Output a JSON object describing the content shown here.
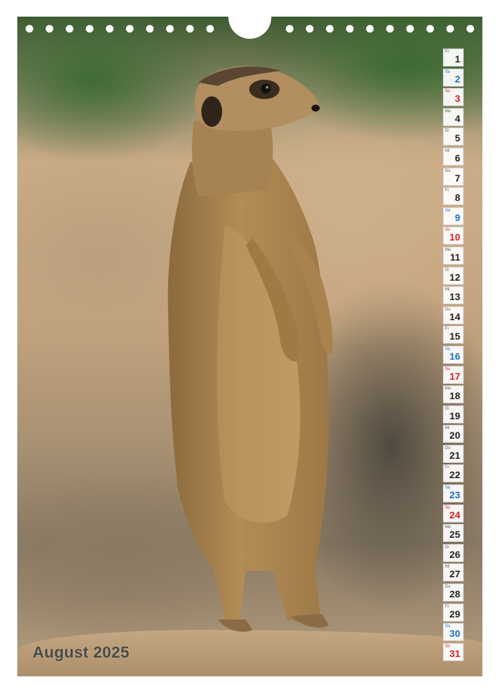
{
  "calendar": {
    "title": "August 2025",
    "days": [
      {
        "wd": "Fr",
        "num": "1",
        "type": "weekday"
      },
      {
        "wd": "Sa",
        "num": "2",
        "type": "sat"
      },
      {
        "wd": "So",
        "num": "3",
        "type": "sun"
      },
      {
        "wd": "Mo",
        "num": "4",
        "type": "weekday"
      },
      {
        "wd": "Di",
        "num": "5",
        "type": "weekday"
      },
      {
        "wd": "Mi",
        "num": "6",
        "type": "weekday"
      },
      {
        "wd": "Do",
        "num": "7",
        "type": "weekday"
      },
      {
        "wd": "Fr",
        "num": "8",
        "type": "weekday"
      },
      {
        "wd": "Sa",
        "num": "9",
        "type": "sat"
      },
      {
        "wd": "So",
        "num": "10",
        "type": "sun"
      },
      {
        "wd": "Mo",
        "num": "11",
        "type": "weekday"
      },
      {
        "wd": "Di",
        "num": "12",
        "type": "weekday"
      },
      {
        "wd": "Mi",
        "num": "13",
        "type": "weekday"
      },
      {
        "wd": "Do",
        "num": "14",
        "type": "weekday"
      },
      {
        "wd": "Fr",
        "num": "15",
        "type": "weekday"
      },
      {
        "wd": "Sa",
        "num": "16",
        "type": "sat"
      },
      {
        "wd": "So",
        "num": "17",
        "type": "sun"
      },
      {
        "wd": "Mo",
        "num": "18",
        "type": "weekday"
      },
      {
        "wd": "Di",
        "num": "19",
        "type": "weekday"
      },
      {
        "wd": "Mi",
        "num": "20",
        "type": "weekday"
      },
      {
        "wd": "Do",
        "num": "21",
        "type": "weekday"
      },
      {
        "wd": "Fr",
        "num": "22",
        "type": "weekday"
      },
      {
        "wd": "Sa",
        "num": "23",
        "type": "sat"
      },
      {
        "wd": "So",
        "num": "24",
        "type": "sun"
      },
      {
        "wd": "Mo",
        "num": "25",
        "type": "weekday"
      },
      {
        "wd": "Di",
        "num": "26",
        "type": "weekday"
      },
      {
        "wd": "Mi",
        "num": "27",
        "type": "weekday"
      },
      {
        "wd": "Do",
        "num": "28",
        "type": "weekday"
      },
      {
        "wd": "Fr",
        "num": "29",
        "type": "weekday"
      },
      {
        "wd": "Sa",
        "num": "30",
        "type": "sat"
      },
      {
        "wd": "So",
        "num": "31",
        "type": "sun"
      }
    ]
  },
  "colors": {
    "saturday": "#1f6fc4",
    "sunday": "#d42020",
    "weekday": "#222222"
  },
  "photo": {
    "subject_icon": "meerkat-photo"
  }
}
